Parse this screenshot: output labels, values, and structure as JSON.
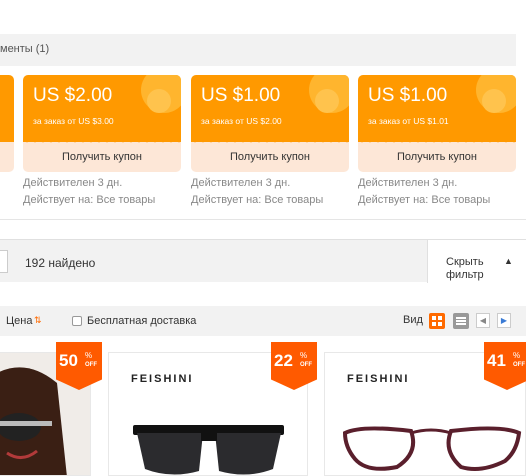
{
  "tabs": {
    "label": "менты (1)"
  },
  "coupons": [
    {
      "amount": "US $2.00",
      "condition": "за заказ от US $3.00",
      "button": "Получить купон",
      "validity": "Действителен 3 дн.",
      "applies": "Действует на: Все товары"
    },
    {
      "amount": "US $1.00",
      "condition": "за заказ от US $2.00",
      "button": "Получить купон",
      "validity": "Действителен 3 дн.",
      "applies": "Действует на: Все товары"
    },
    {
      "amount": "US $1.00",
      "condition": "за заказ от US $1.01",
      "button": "Получить купон",
      "validity": "Действителен 3 дн.",
      "applies": "Действует на: Все товары"
    }
  ],
  "results": {
    "count": "192 найдено",
    "hide_filters": "Скрыть фильтр"
  },
  "sort": {
    "price": "Цена",
    "free_shipping": "Бесплатная доставка",
    "view": "Вид"
  },
  "products": [
    {
      "discount": "50",
      "brand": ""
    },
    {
      "discount": "22",
      "brand": "FEISHINI"
    },
    {
      "discount": "41",
      "brand": "FEISHINI"
    }
  ],
  "badge": {
    "percent": "%",
    "off": "OFF"
  },
  "colors": {
    "accent": "#ff6a00",
    "coupon": "#ff9900",
    "coupon_bottom": "#fde7d7",
    "badge": "#ff5a00"
  }
}
